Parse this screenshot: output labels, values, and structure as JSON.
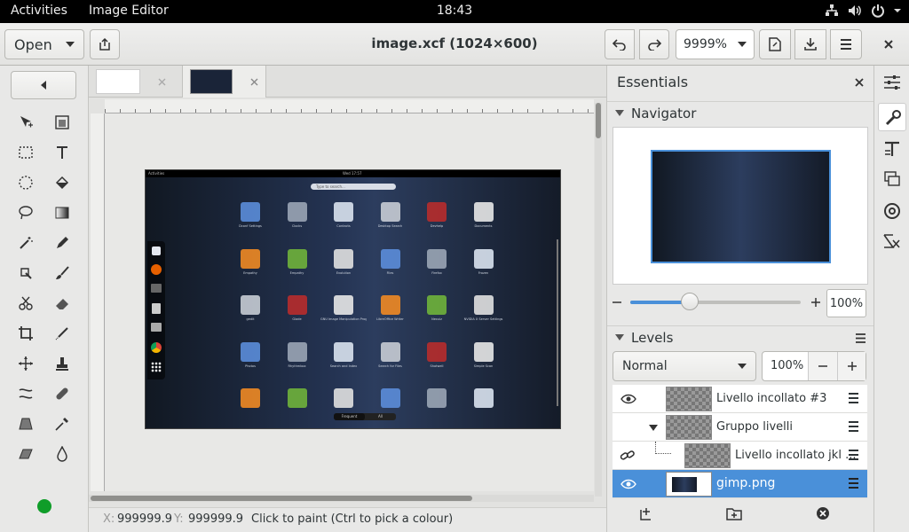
{
  "topbar": {
    "activities": "Activities",
    "app_name": "Image Editor",
    "clock": "18:43"
  },
  "header": {
    "open_label": "Open",
    "title": "image.xcf (1024×600)",
    "zoom_value": "9999%"
  },
  "canvas": {
    "tabs": [
      {
        "name": "tab-image-1"
      },
      {
        "name": "tab-image-2"
      }
    ],
    "screenshot": {
      "topbar_left": "Activities",
      "clock": "Wed 17:57",
      "search_placeholder": "Type to search...",
      "apps": [
        [
          "Dconf Settings",
          "Clocks",
          "Contacts",
          "Desktop Search",
          "Devhelp",
          "Documents"
        ],
        [
          "Empathy",
          "Empathy",
          "Evolution",
          "Files",
          "Firefox",
          "Frozen"
        ],
        [
          "gedit",
          "Glade",
          "GNU Image Manipulation Program",
          "LibreOffice Writer",
          "Nexuiz",
          "NVIDIA X Server Settings"
        ],
        [
          "Photos",
          "Rhythmbox",
          "Search and Index",
          "Search for Files",
          "Shotwell",
          "Simple Scan"
        ],
        [
          "",
          "",
          "",
          "",
          "",
          ""
        ]
      ],
      "bottom_tabs": [
        "Frequent",
        "All"
      ]
    }
  },
  "status": {
    "x_label": "X:",
    "x_value": "999999.9",
    "y_label": "Y:",
    "y_value": "999999.9",
    "message": "Click to paint (Ctrl to pick a colour)"
  },
  "dock": {
    "title": "Essentials",
    "navigator": {
      "label": "Navigator",
      "zoom_value": "100%",
      "zoom_fraction": 0.35
    },
    "levels": {
      "label": "Levels",
      "mode": "Normal",
      "opacity": "100%",
      "layers": [
        {
          "name": "Livello incollato #3"
        },
        {
          "name": "Gruppo livelli"
        },
        {
          "name": "Livello incollato jkl ..."
        },
        {
          "name": "gimp.png"
        }
      ]
    }
  },
  "colors": {
    "accent": "#4a90d9",
    "fg_color_dot": "#0f9d29"
  }
}
